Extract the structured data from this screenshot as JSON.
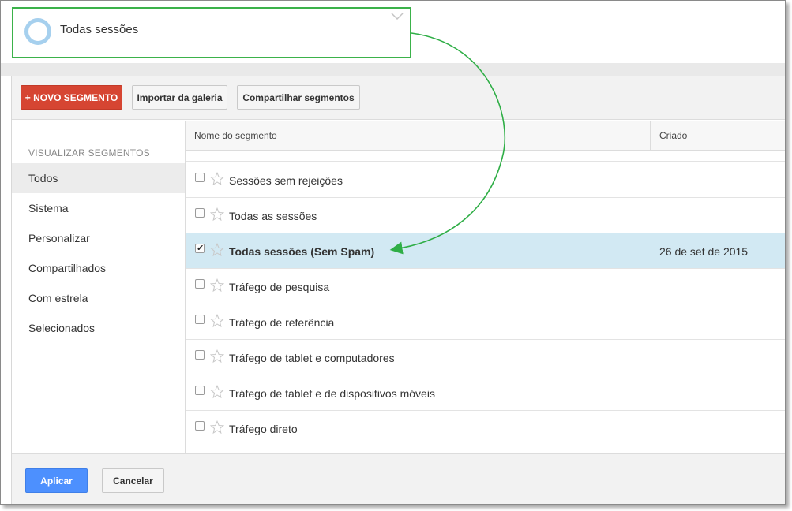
{
  "selected_segment": {
    "title": "Todas sessões",
    "icon": "segment-ring-icon",
    "dropdown_icon": "chevron-down-icon"
  },
  "toolbar": {
    "new_segment_label": "+ NOVO SEGMENTO",
    "import_label": "Importar da galeria",
    "share_label": "Compartilhar segmentos"
  },
  "sidebar": {
    "heading": "VISUALIZAR SEGMENTOS",
    "items": [
      {
        "label": "Todos",
        "active": true
      },
      {
        "label": "Sistema"
      },
      {
        "label": "Personalizar"
      },
      {
        "label": "Compartilhados"
      },
      {
        "label": "Com estrela"
      },
      {
        "label": "Selecionados"
      }
    ]
  },
  "table": {
    "headers": {
      "name": "Nome do segmento",
      "created": "Criado"
    },
    "rows": [
      {
        "name": "Sessões sem rejeições",
        "created": "",
        "checked": false
      },
      {
        "name": "Todas as sessões",
        "created": "",
        "checked": false
      },
      {
        "name": "Todas sessões (Sem Spam)",
        "created": "26 de set de 2015",
        "checked": true
      },
      {
        "name": "Tráfego de pesquisa",
        "created": "",
        "checked": false
      },
      {
        "name": "Tráfego de referência",
        "created": "",
        "checked": false
      },
      {
        "name": "Tráfego de tablet e computadores",
        "created": "",
        "checked": false
      },
      {
        "name": "Tráfego de tablet e de dispositivos móveis",
        "created": "",
        "checked": false
      },
      {
        "name": "Tráfego direto",
        "created": "",
        "checked": false
      }
    ]
  },
  "footer": {
    "apply_label": "Aplicar",
    "cancel_label": "Cancelar"
  },
  "colors": {
    "accent_green": "#3bb24a",
    "new_segment_red": "#d64532",
    "apply_blue": "#4d90fe",
    "selected_row": "#d2e9f3",
    "ring": "#a6d0ee"
  }
}
